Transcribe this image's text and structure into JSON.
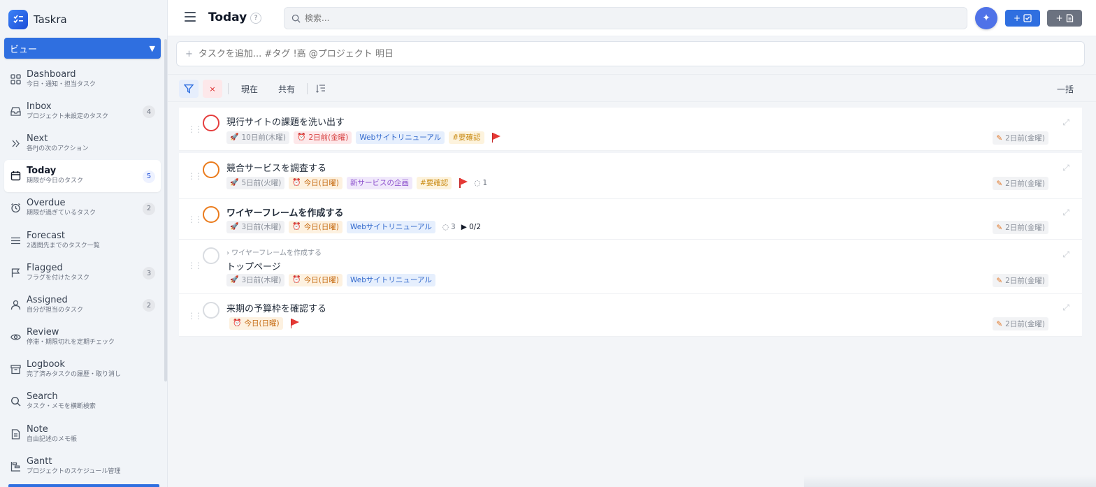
{
  "app": {
    "name": "Taskra"
  },
  "sidebar": {
    "view_select": "ビュー",
    "items": [
      {
        "label": "Dashboard",
        "sub": "今日・通知・担当タスク",
        "count": "",
        "icon": "grid-icon"
      },
      {
        "label": "Inbox",
        "sub": "プロジェクト未設定のタスク",
        "count": "4",
        "icon": "inbox-icon"
      },
      {
        "label": "Next",
        "sub": "各PJの次のアクション",
        "count": "",
        "icon": "double-chevron-icon"
      },
      {
        "label": "Today",
        "sub": "期限が今日のタスク",
        "count": "5",
        "icon": "calendar-icon",
        "active": true
      },
      {
        "label": "Overdue",
        "sub": "期限が過ぎているタスク",
        "count": "2",
        "icon": "alarm-icon"
      },
      {
        "label": "Forecast",
        "sub": "2週間先までのタスク一覧",
        "count": "",
        "icon": "list-icon"
      },
      {
        "label": "Flagged",
        "sub": "フラグを付けたタスク",
        "count": "3",
        "icon": "flag-icon"
      },
      {
        "label": "Assigned",
        "sub": "自分が担当のタスク",
        "count": "2",
        "icon": "person-icon"
      },
      {
        "label": "Review",
        "sub": "停滞・期限切れを定期チェック",
        "count": "",
        "icon": "eye-icon"
      },
      {
        "label": "Logbook",
        "sub": "完了済みタスクの履歴・取り消し",
        "count": "",
        "icon": "archive-icon"
      },
      {
        "label": "Search",
        "sub": "タスク・メモを横断検索",
        "count": "",
        "icon": "search-icon"
      },
      {
        "label": "Note",
        "sub": "自由記述のメモ帳",
        "count": "",
        "icon": "note-icon"
      },
      {
        "label": "Gantt",
        "sub": "プロジェクトのスケジュール管理",
        "count": "",
        "icon": "gantt-icon"
      }
    ]
  },
  "header": {
    "title": "Today",
    "help": "?",
    "search_placeholder": "検索...",
    "ai_icon": "✦",
    "add_task_label": "+",
    "add_note_label": "+"
  },
  "quickadd": {
    "placeholder": "タスクを追加... #タグ !高 @プロジェクト 明日"
  },
  "filterbar": {
    "clear": "×",
    "current": "現在",
    "shared": "共有",
    "bulk": "一括"
  },
  "tasks": [
    {
      "title": "現行サイトの課題を洗い出す",
      "start": "10日前(木曜)",
      "due": "2日前(金曜)",
      "project": "Webサイトリニューアル",
      "tag": "#要確認",
      "updated": "2日前(金曜)"
    },
    {
      "title": "競合サービスを調査する",
      "start": "5日前(火曜)",
      "due": "今日(日曜)",
      "project": "新サービスの企画",
      "tag": "#要確認",
      "comments": "1",
      "updated": "2日前(金曜)"
    },
    {
      "title": "ワイヤーフレームを作成する",
      "start": "3日前(木曜)",
      "due": "今日(日曜)",
      "project": "Webサイトリニューアル",
      "comments": "3",
      "subtasks": "▶ 0/2",
      "updated": "2日前(金曜)"
    },
    {
      "parent": "› ワイヤーフレームを作成する",
      "title": "トップページ",
      "start": "3日前(木曜)",
      "due": "今日(日曜)",
      "project": "Webサイトリニューアル",
      "updated": "2日前(金曜)"
    },
    {
      "title": "来期の予算枠を確認する",
      "due": "今日(日曜)",
      "updated": "2日前(金曜)"
    }
  ]
}
